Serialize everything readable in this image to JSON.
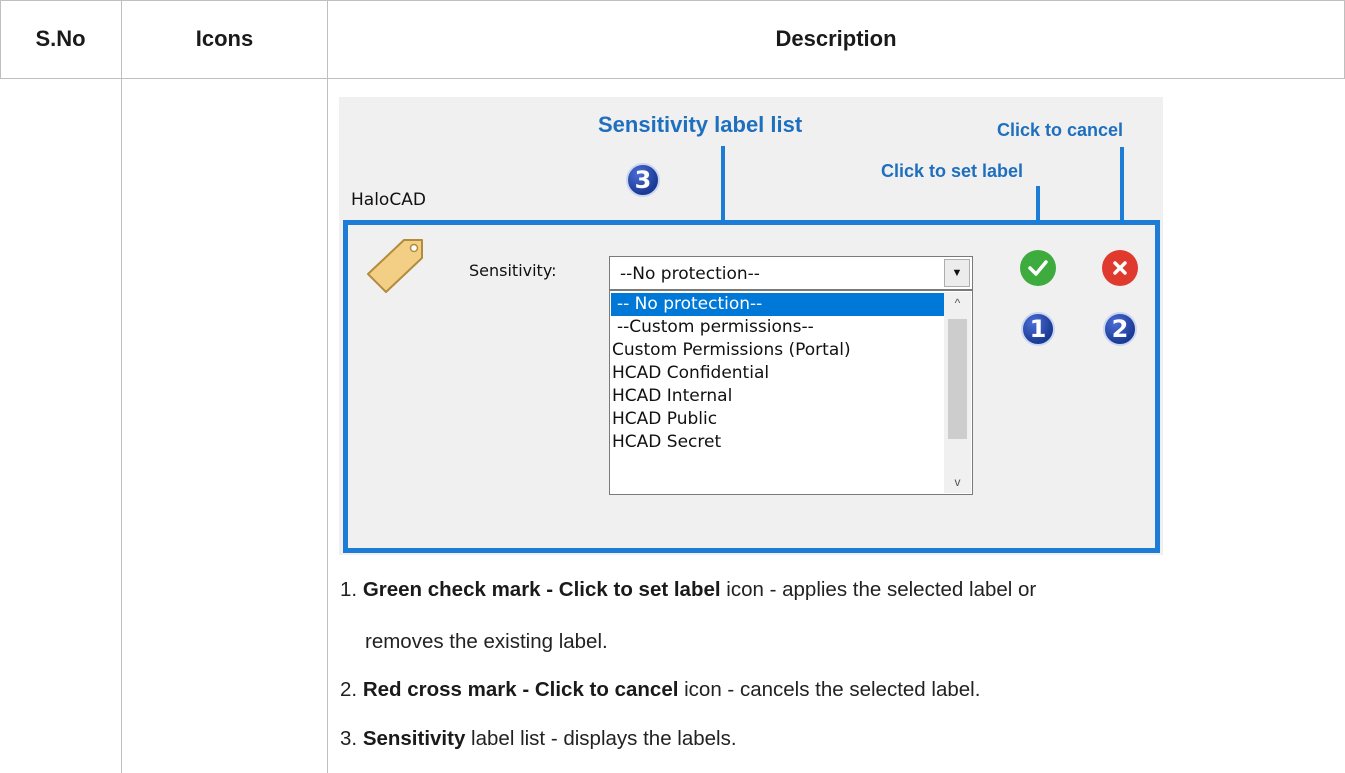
{
  "table": {
    "headers": [
      "S.No",
      "Icons",
      "Description"
    ]
  },
  "figure": {
    "callouts": {
      "sensitivity_list": "Sensitivity label list",
      "cancel": "Click to cancel",
      "set_label": "Click to set label"
    },
    "badges": [
      "1",
      "2",
      "3"
    ],
    "app_name": "HaloCAD",
    "sensitivity_label": "Sensitivity:",
    "combo_value": "--No protection--",
    "list_items": [
      "-- No protection--",
      "--Custom permissions--",
      "Custom Permissions (Portal)",
      "HCAD Confidential",
      "HCAD Internal",
      "HCAD Public",
      "HCAD Secret"
    ],
    "selected_index": 0,
    "colors": {
      "accent": "#1c7cd6",
      "confirm": "#3dab3d",
      "cancel": "#e03a2f",
      "selection": "#0078d7"
    },
    "icons": [
      "tag-icon",
      "check-icon",
      "cross-icon",
      "dropdown-arrow-icon",
      "scroll-up-icon",
      "scroll-down-icon"
    ]
  },
  "description": {
    "items": [
      {
        "num": "1.",
        "bold": "Green check mark - Click to set label",
        "rest": " icon - applies the selected label or"
      },
      {
        "num": "",
        "bold": "",
        "rest": "removes the existing label."
      },
      {
        "num": "2.",
        "bold": "Red cross mark - Click to cancel",
        "rest": " icon - cancels the selected label."
      },
      {
        "num": "3.",
        "bold": "Sensitivity",
        "rest": " label list - displays the labels."
      }
    ]
  }
}
